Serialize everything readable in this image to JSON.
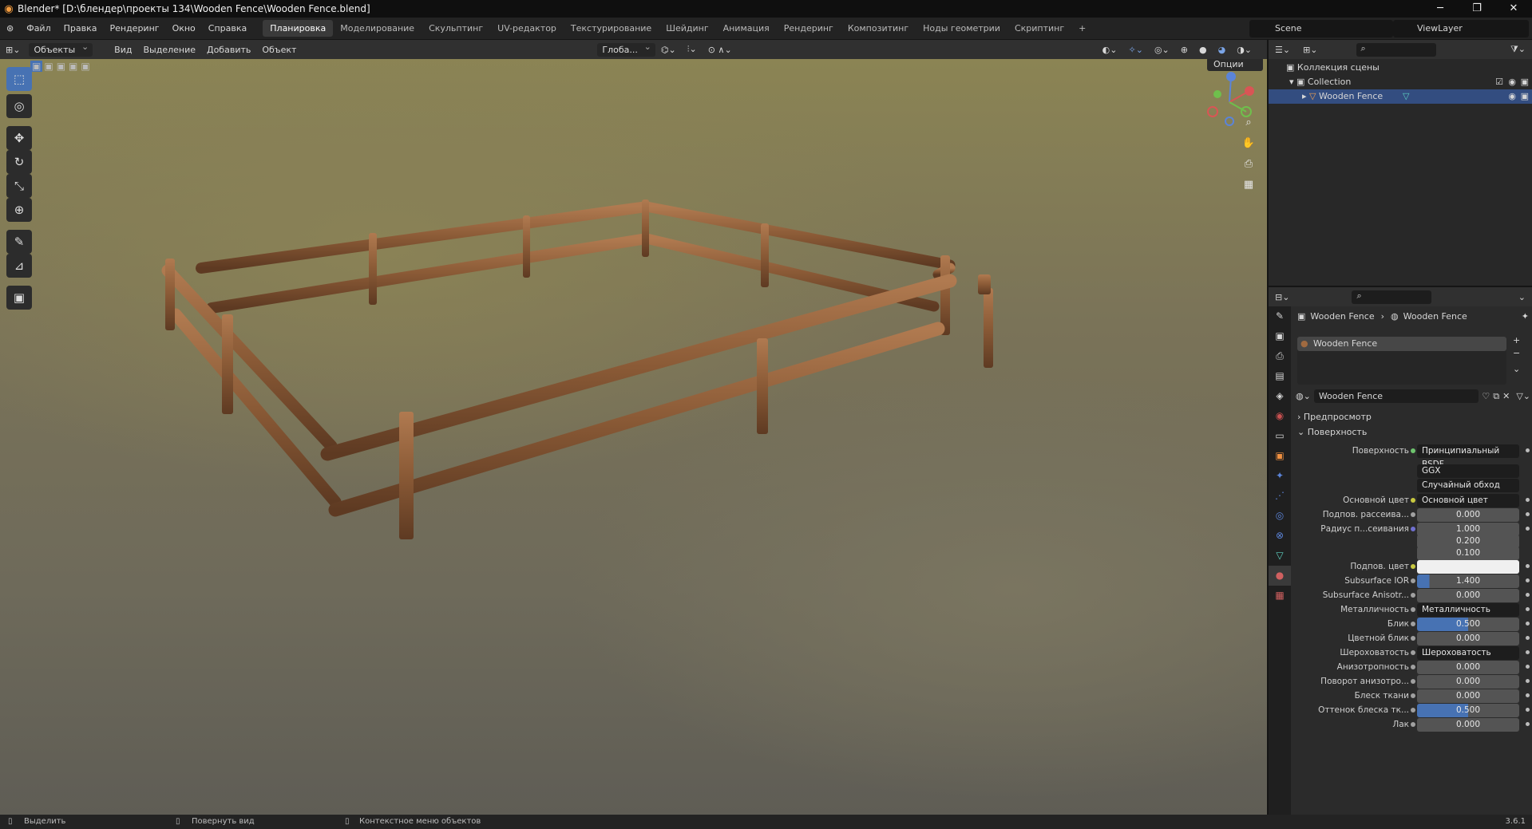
{
  "window": {
    "title": "Blender* [D:\\блендер\\проекты 134\\Wooden Fence\\Wooden Fence.blend]"
  },
  "menu": [
    "Файл",
    "Правка",
    "Рендеринг",
    "Окно",
    "Справка"
  ],
  "workspaces": [
    "Планировка",
    "Моделирование",
    "Скульптинг",
    "UV-редактор",
    "Текстурирование",
    "Шейдинг",
    "Анимация",
    "Рендеринг",
    "Композитинг",
    "Ноды геометрии",
    "Скриптинг"
  ],
  "active_workspace": "Планировка",
  "scene": "Scene",
  "viewlayer": "ViewLayer",
  "viewport": {
    "mode": "Объекты",
    "menus": [
      "Вид",
      "Выделение",
      "Добавить",
      "Объект"
    ],
    "transform": "Глоба...",
    "options": "Опции"
  },
  "outliner": {
    "root": "Коллекция сцены",
    "collection": "Collection",
    "object": "Wooden Fence"
  },
  "props": {
    "breadcrumb_obj": "Wooden Fence",
    "breadcrumb_mat": "Wooden Fence",
    "slot": "Wooden Fence",
    "material": "Wooden Fence",
    "preview": "Предпросмотр",
    "surface_panel": "Поверхность",
    "rows": [
      {
        "label": "Поверхность",
        "value": "Принципиальный BSDF",
        "type": "dark",
        "dot": "#6ec46e"
      },
      {
        "label": "",
        "value": "GGX",
        "type": "dark"
      },
      {
        "label": "",
        "value": "Случайный обход",
        "type": "dark"
      },
      {
        "label": "Основной цвет",
        "value": "Основной цвет",
        "type": "dark",
        "dot": "#c8c840"
      },
      {
        "label": "Подпов. рассеива...",
        "value": "0.000",
        "type": "num",
        "dot": "#a0a0a0"
      },
      {
        "label": "Радиус п...сеивания",
        "value": "1.000",
        "type": "num",
        "dot": "#7070d0"
      },
      {
        "label": "",
        "value": "0.200",
        "type": "num"
      },
      {
        "label": "",
        "value": "0.100",
        "type": "num"
      },
      {
        "label": "Подпов. цвет",
        "value": "",
        "type": "white",
        "dot": "#c8c840"
      },
      {
        "label": "Subsurface IOR",
        "value": "1.400",
        "type": "blue2",
        "dot": "#a0a0a0"
      },
      {
        "label": "Subsurface Anisotr...",
        "value": "0.000",
        "type": "num",
        "dot": "#a0a0a0"
      },
      {
        "label": "Металличность",
        "value": "Металличность",
        "type": "dark",
        "dot": "#a0a0a0"
      },
      {
        "label": "Блик",
        "value": "0.500",
        "type": "blue",
        "dot": "#a0a0a0"
      },
      {
        "label": "Цветной блик",
        "value": "0.000",
        "type": "num",
        "dot": "#a0a0a0"
      },
      {
        "label": "Шероховатость",
        "value": "Шероховатость",
        "type": "dark",
        "dot": "#a0a0a0"
      },
      {
        "label": "Анизотропность",
        "value": "0.000",
        "type": "num",
        "dot": "#a0a0a0"
      },
      {
        "label": "Поворот анизотро...",
        "value": "0.000",
        "type": "num",
        "dot": "#a0a0a0"
      },
      {
        "label": "Блеск ткани",
        "value": "0.000",
        "type": "num",
        "dot": "#a0a0a0"
      },
      {
        "label": "Оттенок блеска тк...",
        "value": "0.500",
        "type": "blue",
        "dot": "#a0a0a0"
      },
      {
        "label": "Лак",
        "value": "0.000",
        "type": "num",
        "dot": "#a0a0a0"
      }
    ]
  },
  "status": {
    "select": "Выделить",
    "rotate": "Повернуть вид",
    "context": "Контекстное меню объектов",
    "version": "3.6.1"
  },
  "colors": {
    "accent": "#4772b3",
    "header": "#303030",
    "wood": "#8a5a36"
  }
}
